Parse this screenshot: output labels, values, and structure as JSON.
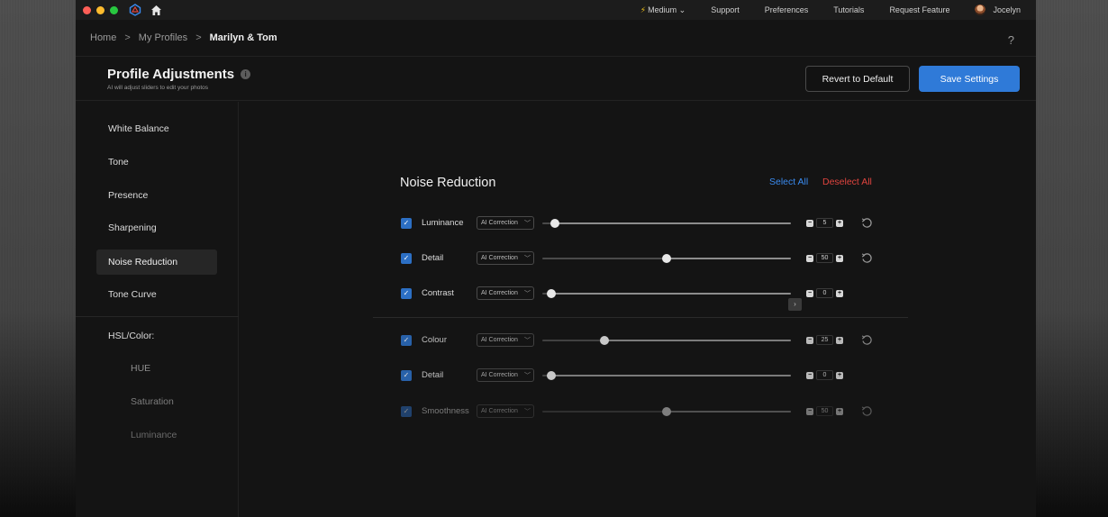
{
  "topbar": {
    "plan_label": "Medium",
    "nav": [
      "Support",
      "Preferences",
      "Tutorials",
      "Request Feature"
    ],
    "user_name": "Jocelyn"
  },
  "breadcrumb": {
    "home": "Home",
    "profiles": "My Profiles",
    "current": "Marilyn & Tom"
  },
  "help_label": "?",
  "header": {
    "title": "Profile Adjustments",
    "info": "i",
    "subtitle": "AI will adjust sliders to edit your photos",
    "revert_label": "Revert to Default",
    "save_label": "Save Settings"
  },
  "sidebar": {
    "items": [
      "White Balance",
      "Tone",
      "Presence",
      "Sharpening",
      "Noise Reduction",
      "Tone Curve"
    ],
    "active": "Noise Reduction",
    "section_label": "HSL/Color:",
    "sub_items": [
      "HUE",
      "Saturation",
      "Luminance"
    ]
  },
  "panel": {
    "title": "Noise Reduction",
    "select_all": "Select All",
    "deselect_all": "Deselect All",
    "rows": [
      {
        "label": "Luminance",
        "mode": "AI Correction",
        "value": "5",
        "level": 5,
        "checked": true,
        "reset": true
      },
      {
        "label": "Detail",
        "mode": "AI Correction",
        "value": "50",
        "level": 50,
        "checked": true,
        "reset": true
      },
      {
        "label": "Contrast",
        "mode": "AI Correction",
        "value": "0",
        "level": 0,
        "checked": true,
        "reset": false
      },
      {
        "label": "Colour",
        "mode": "AI Correction",
        "value": "25",
        "level": 25,
        "checked": true,
        "reset": true
      },
      {
        "label": "Detail",
        "mode": "AI Correction",
        "value": "0",
        "level": 0,
        "checked": true,
        "reset": false
      },
      {
        "label": "Smoothness",
        "mode": "AI Correction",
        "value": "50",
        "level": 50,
        "checked": true,
        "reset": true
      }
    ]
  },
  "colors": {
    "accent": "#2f7ad8",
    "select_all": "#3a8bf0",
    "deselect_all": "#e0443e",
    "window_bg": "#141414"
  }
}
